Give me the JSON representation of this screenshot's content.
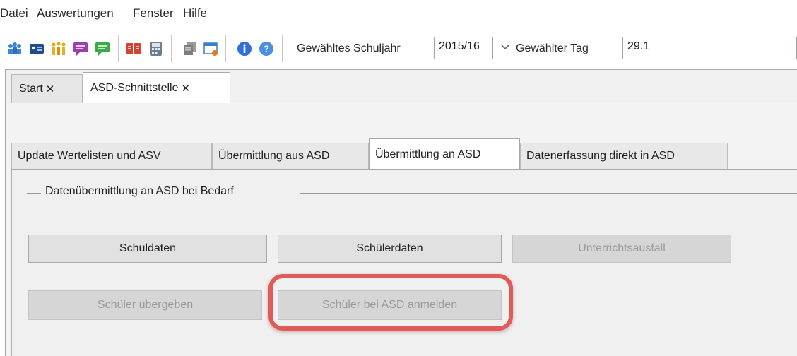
{
  "menu": {
    "items": [
      "Datei",
      "Auswertungen",
      "Fenster",
      "Hilfe"
    ]
  },
  "toolbar": {
    "icons": [
      "people-network-icon",
      "monitor-card-icon",
      "group-people-icon",
      "purple-chat-icon",
      "green-chat-icon",
      "red-book-icon",
      "calculator-icon",
      "copy-pages-icon",
      "window-export-icon",
      "info-icon",
      "help-icon"
    ],
    "schuljahr_label": "Gewähltes Schuljahr",
    "schuljahr_value": "2015/16",
    "tag_label": "Gewählter Tag",
    "tag_value": "29.1"
  },
  "doc_tabs": [
    {
      "label": "Start",
      "active": false
    },
    {
      "label": "ASD-Schnittstelle",
      "active": true
    }
  ],
  "sub_tabs": [
    {
      "label": "Update Wertelisten und ASV",
      "active": false
    },
    {
      "label": "Übermittlung aus ASD",
      "active": false
    },
    {
      "label": "Übermittlung an ASD",
      "active": true
    },
    {
      "label": "Datenerfassung direkt in ASD",
      "active": false
    }
  ],
  "group": {
    "title": "Datenübermittlung an ASD bei Bedarf"
  },
  "buttons": {
    "schuldaten": {
      "label": "Schuldaten",
      "enabled": true
    },
    "schuelerdaten": {
      "label": "Schülerdaten",
      "enabled": true
    },
    "unterrichtsausfall": {
      "label": "Unterrichtsausfall",
      "enabled": false
    },
    "schueler_uebergeben": {
      "label": "Schüler übergeben",
      "enabled": false
    },
    "schueler_anmelden": {
      "label": "Schüler bei ASD anmelden",
      "enabled": false
    }
  },
  "colors": {
    "highlight": "#e05a5a",
    "info_blue": "#2f6fd6",
    "help_blue": "#4a8fe0"
  }
}
